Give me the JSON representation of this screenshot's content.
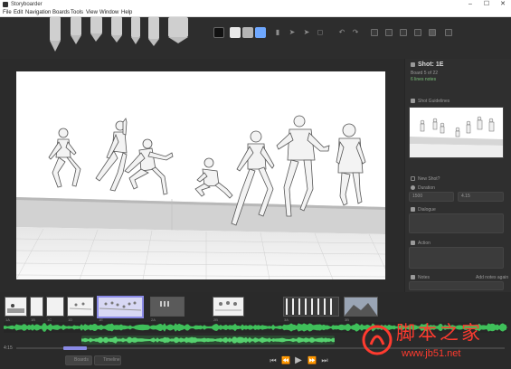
{
  "window": {
    "title": "Storyboarder",
    "minimize": "–",
    "maximize": "☐",
    "close": "✕"
  },
  "menu": [
    "File",
    "Edit",
    "Navigation",
    "Boards",
    "Tools",
    "View",
    "Window",
    "Help"
  ],
  "colors": {
    "accent": "#8a8ae6",
    "swatch_black": "#111111",
    "swatch_light": "#e8e8e8",
    "swatch_gray": "#b5b5b5",
    "swatch_blue": "#6fa8ff",
    "waveform_green": "#3fbf5a",
    "watermark_red": "#ff3b2f"
  },
  "toolbar": {
    "tools": [
      "light-pencil-icon",
      "brush-icon",
      "pen-icon",
      "marker-icon",
      "note-pen-icon",
      "fill-icon",
      "eraser-icon"
    ],
    "action_icons": [
      "add-board-icon",
      "move-icon",
      "transform-icon",
      "comment-icon",
      "undo-icon",
      "redo-icon",
      "shot-grid-icon",
      "layers-icon",
      "camera-icon",
      "onion-skin-icon",
      "captions-icon",
      "sidebar-toggle-icon"
    ]
  },
  "sidebar": {
    "shot_title": "Shot: 1E",
    "board_info": "Board 5 of 22",
    "note_count": "6 lines notes",
    "thumb_label": "Shot Guidelines",
    "new_shot_label": "New Shot?",
    "duration_label": "Duration",
    "duration_ms": "1500",
    "duration_frames": "4.15",
    "dialogue_label": "Dialogue",
    "action_label": "Action",
    "notes_label": "Notes",
    "notes_link": "Add notes again"
  },
  "timeline": {
    "start_time": "4:15",
    "board_numbers": [
      "1A",
      "1B",
      "1C",
      "1D",
      "1E",
      "2A",
      "2B",
      "3A",
      "3B",
      "4A"
    ],
    "mode_buttons": [
      "Boards",
      "Timeline"
    ],
    "controls": [
      "skip-back-icon",
      "rewind-icon",
      "play-icon",
      "forward-icon",
      "skip-forward-icon"
    ]
  },
  "watermark": {
    "logo_text": "脚本之家",
    "url": "www.jb51.net"
  }
}
